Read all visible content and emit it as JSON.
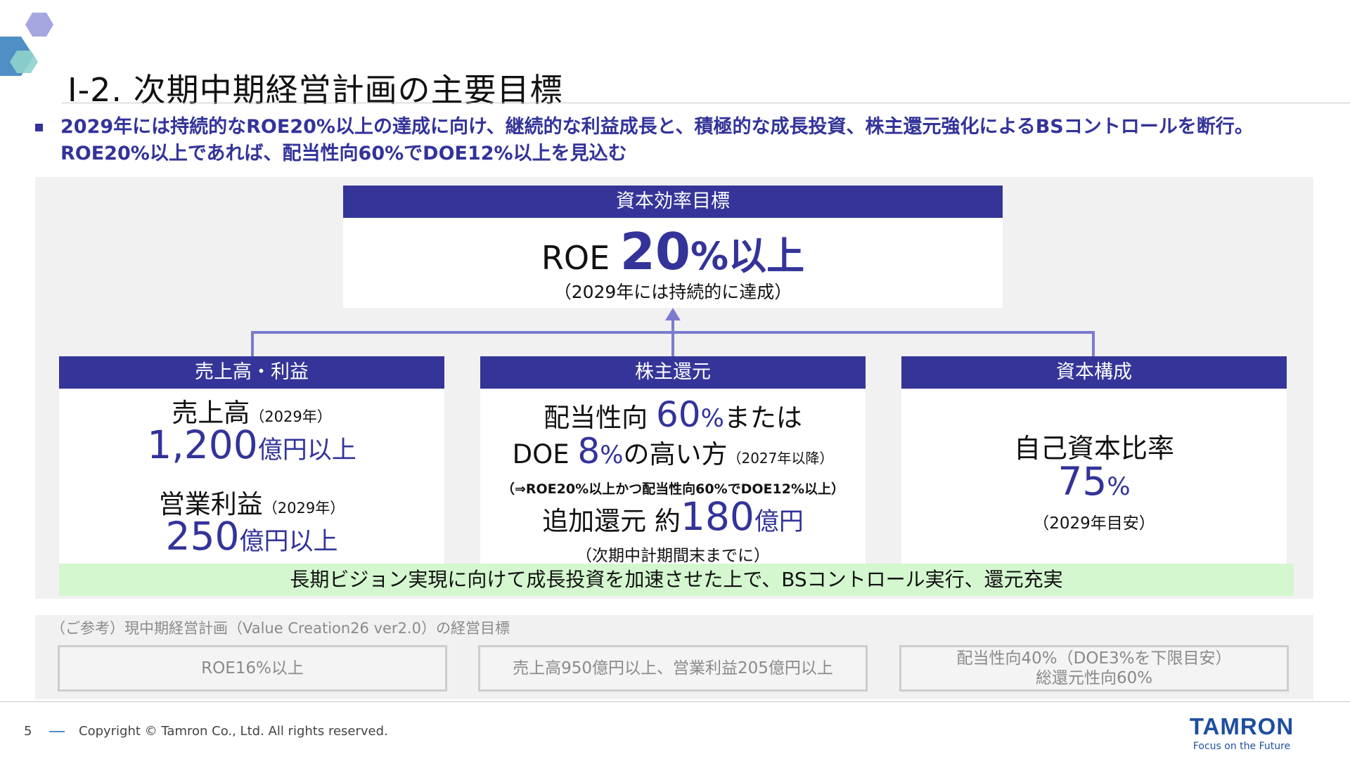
{
  "slide": {
    "title": "Ⅰ-2. 次期中期経営計画の主要目標",
    "lead_line1": "2029年には持続的なROE20%以上の達成に向け、継続的な利益成長と、積極的な成長投資、株主還元強化によるBSコントロールを断行。",
    "lead_line2": "ROE20%以上であれば、配当性向60%でDOE12%以上を見込む"
  },
  "top_box": {
    "header": "資本効率目標",
    "roe_label": "ROE ",
    "roe_value": "20",
    "roe_unit": "%以上",
    "note": "（2029年には持続的に達成）"
  },
  "box_sales": {
    "header": "売上高・利益",
    "sales_label": "売上高",
    "sales_year": "（2029年）",
    "sales_value": "1,200",
    "sales_unit": "億円以上",
    "op_label": "営業利益",
    "op_year": "（2029年）",
    "op_value": "250",
    "op_unit": "億円以上"
  },
  "box_return": {
    "header": "株主還元",
    "payout_label": "配当性向 ",
    "payout_value": "60",
    "payout_unit": "%",
    "payout_suffix": "または",
    "doe_label": "DOE ",
    "doe_value": "8",
    "doe_unit": "%",
    "doe_suffix": "の高い方",
    "doe_note": "（2027年以降）",
    "condition": "（⇒ROE20%以上かつ配当性向60%でDOE12%以上）",
    "add_label": "追加還元 約",
    "add_value": "180",
    "add_unit": "億円",
    "add_note": "（次期中計期間末までに）"
  },
  "box_capital": {
    "header": "資本構成",
    "ratio_label": "自己資本比率",
    "ratio_value": "75",
    "ratio_unit": "%",
    "ratio_note": "（2029年目安）"
  },
  "banner": "長期ビジョン実現に向けて成長投資を加速させた上で、BSコントロール実行、還元充実",
  "reference": {
    "title": "（ご参考）現中期経営計画（Value Creation26 ver2.0）の経営目標",
    "box1": "ROE16%以上",
    "box2": "売上高950億円以上、営業利益205億円以上",
    "box3_line1": "配当性向40%（DOE3%を下限目安）",
    "box3_line2": "総還元性向60%"
  },
  "footer": {
    "page_number": "5",
    "copyright": "Copyright © Tamron Co., Ltd. All rights reserved.",
    "logo_text": "TAMRON",
    "tagline": "Focus on the Future"
  },
  "colors": {
    "navy": "#353599",
    "lead_text": "#33339a",
    "banner_green": "#d4f7cf",
    "connector": "#7b7bcf"
  }
}
